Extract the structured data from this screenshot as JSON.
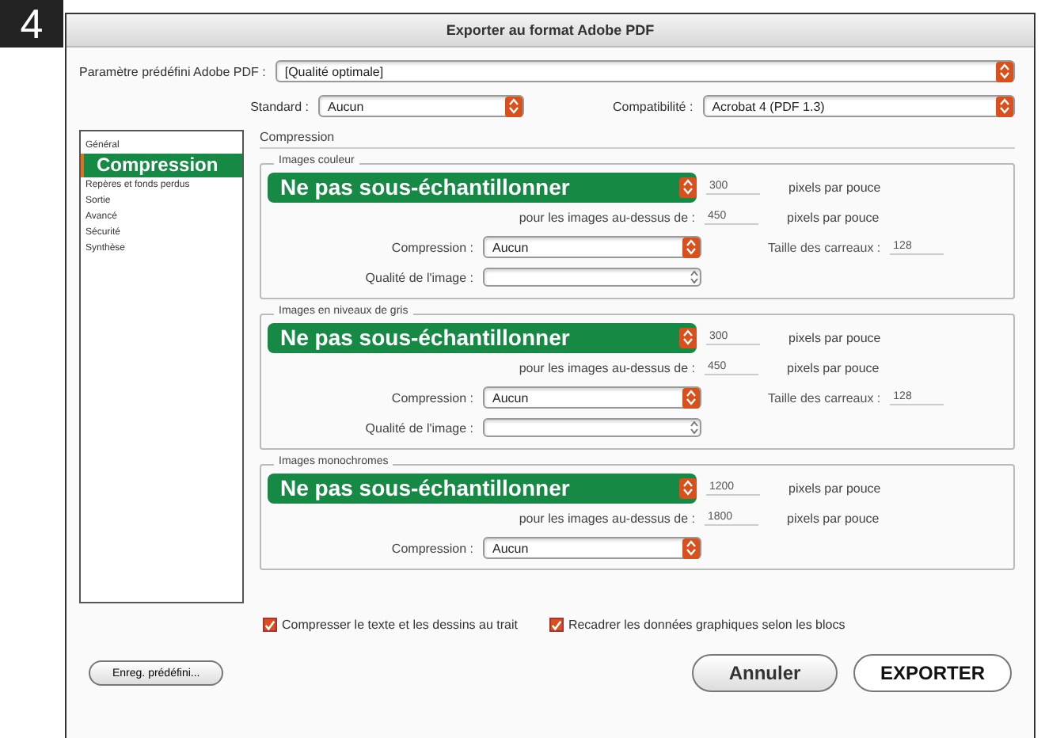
{
  "badge": "4",
  "window": {
    "title": "Exporter au format Adobe PDF"
  },
  "preset": {
    "label": "Paramètre prédéfini Adobe PDF :",
    "value": "[Qualité optimale]"
  },
  "standard": {
    "label": "Standard :",
    "value": "Aucun"
  },
  "compatibility": {
    "label": "Compatibilité :",
    "value": "Acrobat 4 (PDF 1.3)"
  },
  "sidebar": {
    "items": [
      {
        "label": "Général",
        "selected": false
      },
      {
        "label": "Compression",
        "selected": true
      },
      {
        "label": "Repères et fonds perdus",
        "selected": false
      },
      {
        "label": "Sortie",
        "selected": false
      },
      {
        "label": "Avancé",
        "selected": false
      },
      {
        "label": "Sécurité",
        "selected": false
      },
      {
        "label": "Synthèse",
        "selected": false
      }
    ]
  },
  "panel_title": "Compression",
  "sections": [
    {
      "title": "Images couleur",
      "sampling": "Ne pas sous-échantillonner",
      "resolution": "300",
      "resolution_unit": "pixels par pouce",
      "threshold_label": "pour les images au-dessus de :",
      "threshold": "450",
      "threshold_unit": "pixels par pouce",
      "compression_label": "Compression :",
      "compression": "Aucun",
      "tile_label": "Taille des carreaux :",
      "tile": "128",
      "quality_label": "Qualité de l'image :"
    },
    {
      "title": "Images en niveaux de gris",
      "sampling": "Ne pas sous-échantillonner",
      "resolution": "300",
      "resolution_unit": "pixels par pouce",
      "threshold_label": "pour les images au-dessus de :",
      "threshold": "450",
      "threshold_unit": "pixels par pouce",
      "compression_label": "Compression :",
      "compression": "Aucun",
      "tile_label": "Taille des carreaux :",
      "tile": "128",
      "quality_label": "Qualité de l'image :"
    },
    {
      "title": "Images monochromes",
      "sampling": "Ne pas sous-échantillonner",
      "resolution": "1200",
      "resolution_unit": "pixels par pouce",
      "threshold_label": "pour les images au-dessus de :",
      "threshold": "1800",
      "threshold_unit": "pixels par pouce",
      "compression_label": "Compression :",
      "compression": "Aucun"
    }
  ],
  "options": [
    {
      "label": "Compresser le texte et les dessins au trait",
      "checked": true
    },
    {
      "label": "Recadrer les données graphiques selon les blocs",
      "checked": true
    }
  ],
  "buttons": {
    "save_preset": "Enreg. prédéfini...",
    "cancel": "Annuler",
    "export": "EXPORTER"
  }
}
